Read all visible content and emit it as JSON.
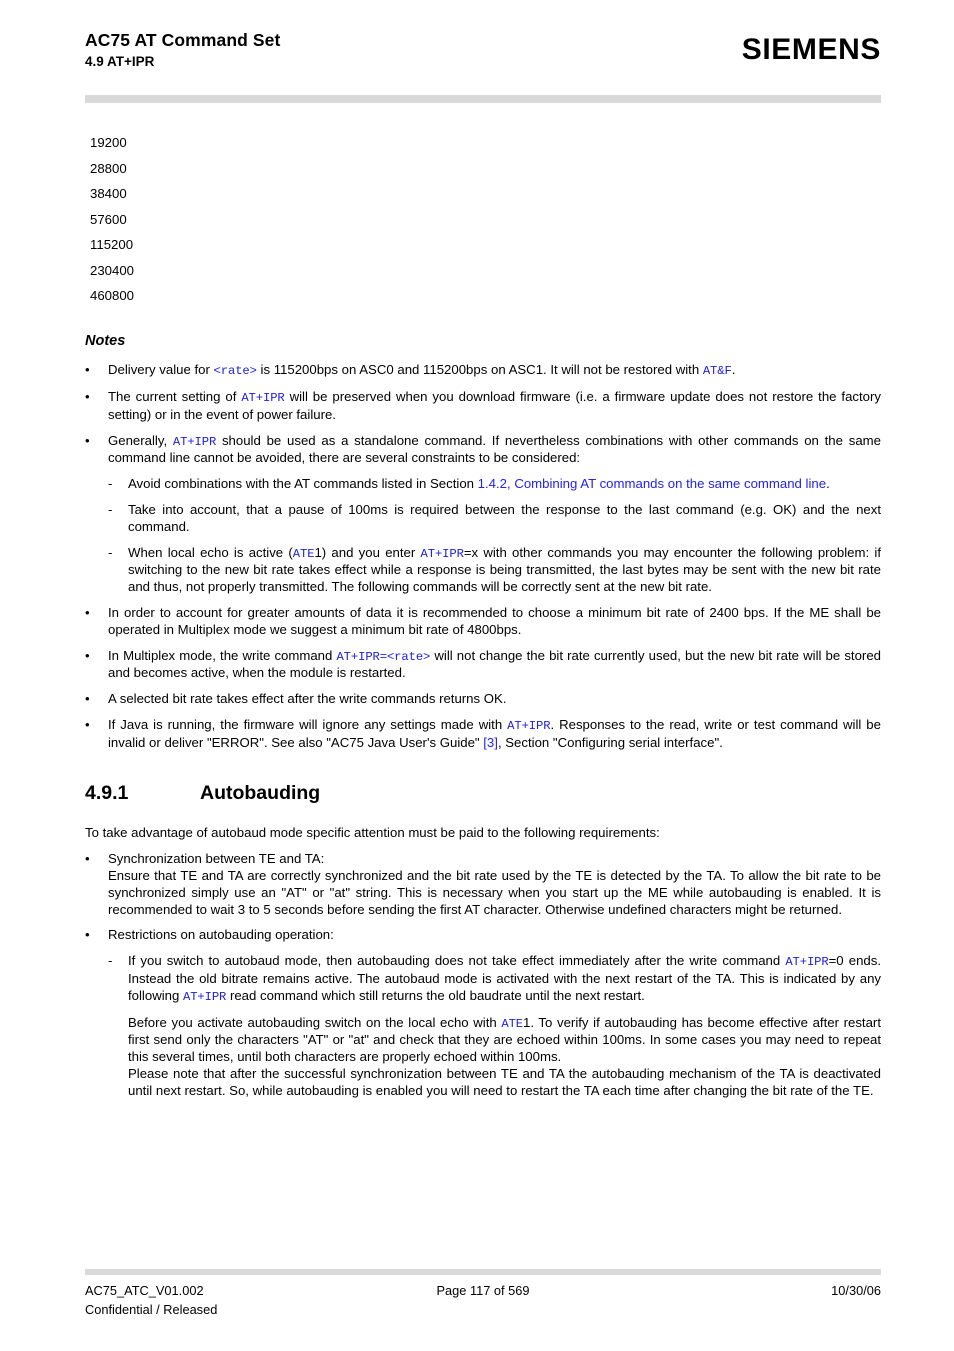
{
  "header": {
    "doc_title": "AC75 AT Command Set",
    "section_label": "4.9 AT+IPR",
    "brand": "SIEMENS"
  },
  "rates": {
    "items": [
      "19200",
      "28800",
      "38400",
      "57600",
      "115200",
      "230400",
      "460800"
    ]
  },
  "notes": {
    "heading": "Notes",
    "bullet_marker": "•",
    "dash_marker": "-",
    "items": [
      {
        "parts": [
          {
            "t": "Delivery value for ",
            "s": "plain"
          },
          {
            "t": "<rate>",
            "s": "code"
          },
          {
            "t": " is 115200bps on ASC0 and 115200bps on ASC1. It will not be restored with ",
            "s": "plain"
          },
          {
            "t": "AT&F",
            "s": "code"
          },
          {
            "t": ".",
            "s": "plain"
          }
        ]
      },
      {
        "parts": [
          {
            "t": "The current setting of ",
            "s": "plain"
          },
          {
            "t": "AT+IPR",
            "s": "code"
          },
          {
            "t": " will be preserved when you download firmware (i.e. a firmware update does not restore the factory setting) or in the event of power failure.",
            "s": "plain"
          }
        ]
      },
      {
        "parts": [
          {
            "t": "Generally, ",
            "s": "plain"
          },
          {
            "t": "AT+IPR",
            "s": "code"
          },
          {
            "t": " should be used as a standalone command. If nevertheless combinations with other commands on the same command line cannot be avoided, there are several constraints to be considered:",
            "s": "plain"
          }
        ]
      }
    ],
    "subitems": [
      {
        "parts": [
          {
            "t": "Avoid combinations with the AT commands listed in Section ",
            "s": "plain"
          },
          {
            "t": "1.4.2, Combining AT commands on the same command line",
            "s": "link"
          },
          {
            "t": ".",
            "s": "plain"
          }
        ]
      },
      {
        "parts": [
          {
            "t": "Take into account, that a pause of 100ms is required between the response to the last command (e.g. OK) and the next command.",
            "s": "plain"
          }
        ]
      },
      {
        "parts": [
          {
            "t": "When local echo is active (",
            "s": "plain"
          },
          {
            "t": "ATE",
            "s": "code"
          },
          {
            "t": "1) and you enter ",
            "s": "plain"
          },
          {
            "t": "AT+IPR",
            "s": "code"
          },
          {
            "t": "=x with other commands you may encounter the following problem: if switching to the new bit rate takes effect while a response is being transmitted, the last bytes may be sent with the new bit rate and thus, not properly transmitted. The following commands will be correctly sent at the new bit rate.",
            "s": "plain"
          }
        ]
      }
    ],
    "items_after": [
      {
        "parts": [
          {
            "t": "In order to account for greater amounts of data it is recommended to choose a minimum bit rate of 2400 bps. If the ME shall be operated in Multiplex mode we suggest a minimum bit rate of 4800bps.",
            "s": "plain"
          }
        ]
      },
      {
        "parts": [
          {
            "t": "In Multiplex mode, the write command ",
            "s": "plain"
          },
          {
            "t": "AT+IPR=<rate>",
            "s": "code"
          },
          {
            "t": " will not change the bit rate currently used, but the new bit rate will be stored and becomes active, when the module is restarted.",
            "s": "plain"
          }
        ]
      },
      {
        "parts": [
          {
            "t": "A selected bit rate takes effect after the write commands returns OK.",
            "s": "plain"
          }
        ]
      },
      {
        "parts": [
          {
            "t": "If Java is running, the firmware will ignore any settings made with ",
            "s": "plain"
          },
          {
            "t": "AT+IPR",
            "s": "code"
          },
          {
            "t": ". Responses to the read, write or test command will be invalid or deliver \"ERROR\". See also \"AC75 Java User's Guide\" ",
            "s": "plain"
          },
          {
            "t": "[3]",
            "s": "link"
          },
          {
            "t": ", Section \"Configuring serial interface\".",
            "s": "plain"
          }
        ]
      }
    ]
  },
  "section": {
    "number": "4.9.1",
    "title": "Autobauding",
    "intro": "To take advantage of autobaud mode specific attention must be paid to the following requirements:",
    "bullets": [
      {
        "parts": [
          {
            "t": "Synchronization between TE and TA:",
            "s": "plain"
          },
          {
            "t": "\n",
            "s": "break"
          },
          {
            "t": "Ensure that TE and TA are correctly synchronized and the bit rate used by the TE is detected by the TA. To allow the bit rate to be synchronized simply use an \"AT\" or \"at\" string. This is necessary when you start up the ME while autobauding is enabled. It is recommended to wait 3 to 5 seconds before sending the first AT character. Otherwise undefined characters might be returned.",
            "s": "plain"
          }
        ]
      },
      {
        "parts": [
          {
            "t": "Restrictions on autobauding operation:",
            "s": "plain"
          }
        ]
      }
    ],
    "subitems": [
      {
        "parts": [
          {
            "t": "If you switch to autobaud mode, then autobauding does not take effect immediately after the write command ",
            "s": "plain"
          },
          {
            "t": "AT+IPR",
            "s": "code"
          },
          {
            "t": "=0 ends. Instead the old bitrate remains active. The autobaud mode is activated with the next restart of the TA. This is indicated by any following ",
            "s": "plain"
          },
          {
            "t": "AT+IPR",
            "s": "code"
          },
          {
            "t": " read command which still returns the old baudrate until the next restart.",
            "s": "plain"
          }
        ]
      }
    ],
    "sub_paragraphs": [
      {
        "parts": [
          {
            "t": "Before you activate autobauding switch on the local echo with ",
            "s": "plain"
          },
          {
            "t": "ATE",
            "s": "code"
          },
          {
            "t": "1. To verify if autobauding has become effective after restart first send only the characters \"AT\" or \"at\" and check that they are echoed within 100ms. In some cases you may need to repeat this several times, until both characters are properly echoed within 100ms.",
            "s": "plain"
          }
        ]
      },
      {
        "parts": [
          {
            "t": "Please note that after the successful synchronization between TE and TA the autobauding mechanism of the TA is deactivated until next restart. So, while autobauding is enabled you will need to restart the TA each time after changing the bit rate of the TE.",
            "s": "plain"
          }
        ]
      }
    ]
  },
  "footer": {
    "doc_id": "AC75_ATC_V01.002",
    "classification": "Confidential / Released",
    "page": "Page 117 of 569",
    "date": "10/30/06"
  },
  "colors": {
    "code_blue": "#2020dd",
    "link_blue": "#2222ee",
    "rule_gray": "#d9d9d9"
  }
}
